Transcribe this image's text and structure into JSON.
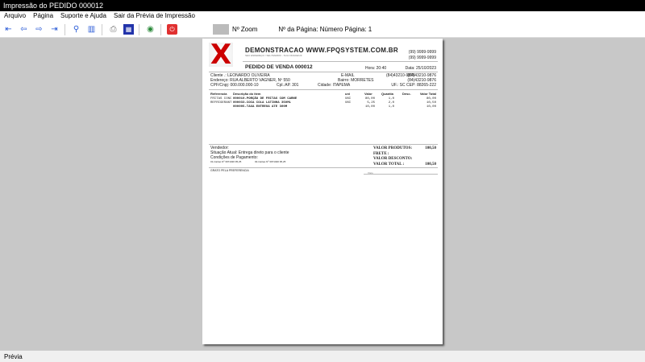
{
  "window": {
    "title": "Impressão do PEDIDO 000012"
  },
  "menu": [
    "Arquivo",
    "Página",
    "Suporte e Ajuda",
    "Sair da Prévia de Impressão"
  ],
  "toolbar": {
    "zoom_label": "Nº Zoom",
    "page_label": "Nº da Página: Número Página: 1"
  },
  "doc": {
    "company": "DEMONSTRACAO WWW.FPQSYSTEM.COM.BR",
    "address": "SEU ENDEREÇO / SEU BAIRRO - SUA CIDADE/UF",
    "phone1": "(99) 9999-9999",
    "phone2": "(99) 9999-9999",
    "order_title": "PEDIDO DE VENDA 000012",
    "time": "Hora: 20:40",
    "date": "Data: 25/10/2023",
    "cliente": "Cliente   .: LEONARDO OLIVEIRA",
    "endereco": "Endereço: RUA ALBERTO VAGNER, Nº 550",
    "cpf": "CPF/Cnpj: 000.000.000-10",
    "cpl": "Cpl.:AP. 301",
    "email": "E-MAIL",
    "tel1": "(84)43210-9876",
    "tel2": "(84)43210-9876",
    "tel3": "(84)43210-9876",
    "bairro": "Bairro: MORRETES",
    "cidade": "Cidade: ITAPEMA",
    "uf": "UF.: SC  CEP: 88265-222",
    "headers": [
      "Referencia",
      "Descrição do item",
      "uni",
      "Valor",
      "Quantia",
      "Desc.",
      "Valor Total"
    ],
    "items": [
      [
        "FRITAS CONC",
        "000010-PORÇÃO DE FRITAS COM CARNE",
        "UNI",
        "80,00",
        "1,0",
        "",
        "80,00"
      ],
      [
        "REFRIGERANT",
        "000033-COCA COLA LATINHA 350ML",
        "UNI",
        "5,25",
        "2,0",
        "",
        "10,50"
      ],
      [
        "",
        "000005-TAXA ENTREGA ATE 300M",
        "",
        "10,00",
        "1,0",
        "",
        "10,00"
      ]
    ],
    "vendedor": "Vendedor:",
    "situacao": "Situação Atual: Entrega direto para o cliente",
    "condicoes": "Condições de Pagamento:",
    "parcela1": "01-Cartao Nº 3971020    95,25",
    "parcela2": "02-Cartao Nº 3971020    95,25",
    "thanks": "GRATO PELA PREFERENCIA",
    "sign": "Visto",
    "totals": [
      [
        "VALOR PRODUTOS:",
        "100,50"
      ],
      [
        "FRETE          :",
        ""
      ],
      [
        "VALOR DESCONTO:",
        ""
      ],
      [
        "VALOR TOTAL    :",
        "100,50"
      ]
    ]
  },
  "status": "Prévia"
}
